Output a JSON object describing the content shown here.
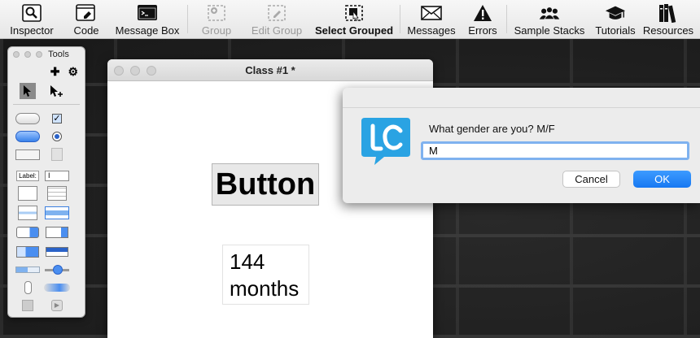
{
  "toolbar": {
    "items": [
      {
        "label": "Inspector",
        "icon": "magnifier-icon"
      },
      {
        "label": "Code",
        "icon": "script-icon"
      },
      {
        "label": "Message Box",
        "icon": "terminal-icon"
      },
      {
        "label": "Group",
        "icon": "group-icon"
      },
      {
        "label": "Edit Group",
        "icon": "edit-group-icon"
      },
      {
        "label": "Select Grouped",
        "icon": "select-grouped-icon"
      },
      {
        "label": "Messages",
        "icon": "envelope-icon"
      },
      {
        "label": "Errors",
        "icon": "warning-icon"
      },
      {
        "label": "Sample Stacks",
        "icon": "people-icon"
      },
      {
        "label": "Tutorials",
        "icon": "graduation-cap-icon"
      },
      {
        "label": "Resources",
        "icon": "books-icon"
      }
    ]
  },
  "tools_palette": {
    "title": "Tools",
    "label_tool_text": "Label:",
    "text_field_glyph": "I"
  },
  "card_window": {
    "title": "Class #1 *",
    "button_label": "Button",
    "field_line1": "144",
    "field_line2": "months"
  },
  "dialog": {
    "prompt": "What gender are you? M/F",
    "answer_value": "M",
    "cancel_label": "Cancel",
    "ok_label": "OK"
  },
  "colors": {
    "accent": "#1778f2",
    "focus_ring": "#7fb2ef",
    "logo_blue": "#2aa3e3"
  }
}
